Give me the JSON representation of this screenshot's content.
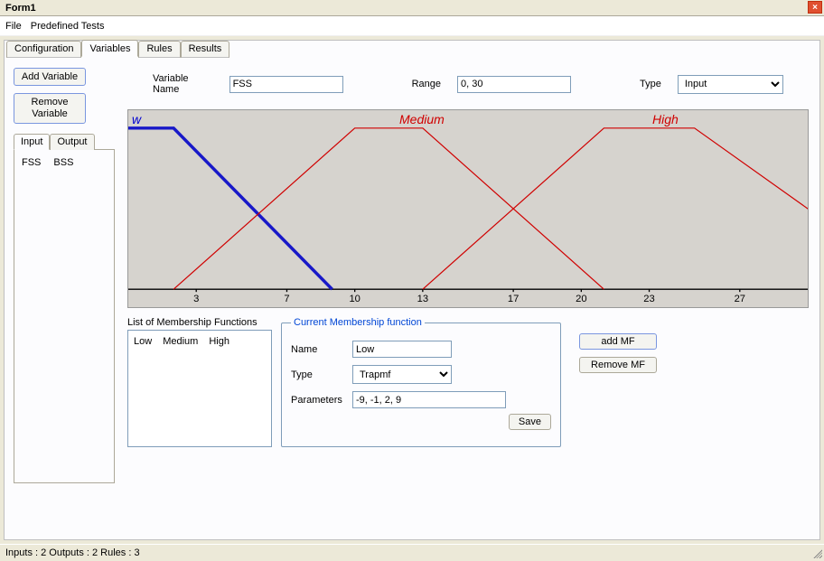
{
  "window": {
    "title": "Form1"
  },
  "menu": {
    "file": "File",
    "predef": "Predefined Tests"
  },
  "tabs": {
    "config": "Configuration",
    "variables": "Variables",
    "rules": "Rules",
    "results": "Results"
  },
  "left": {
    "add_var": "Add Variable",
    "remove_var": "Remove\nVariable",
    "sub_tabs": {
      "input": "Input",
      "output": "Output"
    },
    "vars": {
      "a": "FSS",
      "b": "BSS"
    }
  },
  "form": {
    "var_name_label": "Variable Name",
    "var_name_value": "FSS",
    "range_label": "Range",
    "range_value": "0, 30",
    "type_label": "Type",
    "type_value": "Input"
  },
  "chart_data": {
    "type": "line",
    "xlim": [
      0,
      30
    ],
    "ylim": [
      0,
      1
    ],
    "x_ticks": [
      3,
      7,
      10,
      13,
      17,
      20,
      23,
      27
    ],
    "series": [
      {
        "name": "Low",
        "selected": true,
        "points": [
          [
            -9,
            0
          ],
          [
            -1,
            1
          ],
          [
            2,
            1
          ],
          [
            9,
            0
          ]
        ]
      },
      {
        "name": "Medium",
        "selected": false,
        "points": [
          [
            2,
            0
          ],
          [
            10,
            1
          ],
          [
            13,
            1
          ],
          [
            21,
            0
          ]
        ]
      },
      {
        "name": "High",
        "selected": false,
        "points": [
          [
            13,
            0
          ],
          [
            21,
            1
          ],
          [
            25,
            1
          ],
          [
            35,
            0
          ]
        ]
      }
    ],
    "labels": {
      "low": "w",
      "medium": "Medium",
      "high": "High"
    }
  },
  "mf_list": {
    "title": "List of Membership Functions",
    "items": {
      "a": "Low",
      "b": "Medium",
      "c": "High"
    }
  },
  "current_mf": {
    "legend": "Current Membership function",
    "name_label": "Name",
    "name_value": "Low",
    "type_label": "Type",
    "type_value": "Trapmf",
    "params_label": "Parameters",
    "params_value": "-9, -1, 2, 9",
    "save": "Save"
  },
  "mf_buttons": {
    "add": "add MF",
    "remove": "Remove MF"
  },
  "status": "Inputs : 2  Outputs : 2  Rules : 3"
}
